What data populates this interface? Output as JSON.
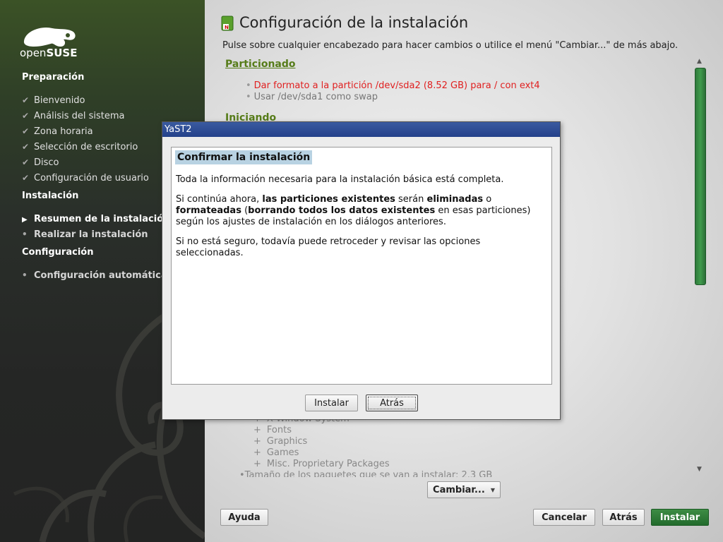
{
  "sidebar": {
    "logo_text_light": "open",
    "logo_text_bold": "SUSE",
    "sections": [
      {
        "title": "Preparación",
        "items": [
          {
            "label": "Bienvenido",
            "state": "done"
          },
          {
            "label": "Análisis del sistema",
            "state": "done"
          },
          {
            "label": "Zona horaria",
            "state": "done"
          },
          {
            "label": "Selección de escritorio",
            "state": "done"
          },
          {
            "label": "Disco",
            "state": "done"
          },
          {
            "label": "Configuración de usuario",
            "state": "done"
          }
        ]
      },
      {
        "title": "Instalación",
        "items": [
          {
            "label": "Resumen de la instalación",
            "state": "current"
          },
          {
            "label": "Realizar la instalación",
            "state": "pending"
          }
        ]
      },
      {
        "title": "Configuración",
        "items": [
          {
            "label": "Configuración automática",
            "state": "pending"
          }
        ]
      }
    ],
    "icons": {
      "done": "check-icon",
      "current": "triangle-right-icon",
      "pending": "dot-icon"
    }
  },
  "main": {
    "title": "Configuración de la instalación",
    "subtitle": "Pulse sobre cualquier encabezado para hacer cambios o utilice el menú \"Cambiar...\" de más abajo.",
    "partition_section": {
      "heading": "Particionado",
      "items": [
        {
          "text": "Dar formato a la partición /dev/sda2 (8.52 GB) para / con ext4",
          "color": "#e02020"
        },
        {
          "text": "Usar /dev/sda1 como swap",
          "color": "#777777"
        }
      ]
    },
    "boot_section": {
      "heading": "Iniciando"
    },
    "software_items": [
      "X Window System",
      "Fonts",
      "Graphics",
      "Games",
      "Misc. Proprietary Packages"
    ],
    "package_size": "Tamaño de los paquetes que se van a instalar: 2.3 GB",
    "buttons": {
      "change": "Cambiar...",
      "help": "Ayuda",
      "cancel": "Cancelar",
      "back": "Atrás",
      "install": "Instalar"
    }
  },
  "dialog": {
    "window_title": "YaST2",
    "heading": "Confirmar la instalación",
    "p1": "Toda la información necesaria para la instalación básica está completa.",
    "p2_a": "Si continúa ahora, ",
    "p2_b": "las particiones existentes",
    "p2_c": " serán ",
    "p2_d": "eliminadas",
    "p2_e": " o ",
    "p2_f": "formateadas",
    "p2_g": " (",
    "p2_h": "borrando todos los datos existentes",
    "p2_i": " en esas particiones) según los ajustes de instalación en los diálogos anteriores.",
    "p3": "Si no está seguro, todavía puede retroceder y revisar las opciones seleccionadas.",
    "buttons": {
      "install": "Instalar",
      "back": "Atrás"
    }
  },
  "colors": {
    "accent_green": "#567c19",
    "install_green": "#2b7534",
    "dialog_titlebar": "#2e4c94",
    "warning_red": "#e02020"
  }
}
